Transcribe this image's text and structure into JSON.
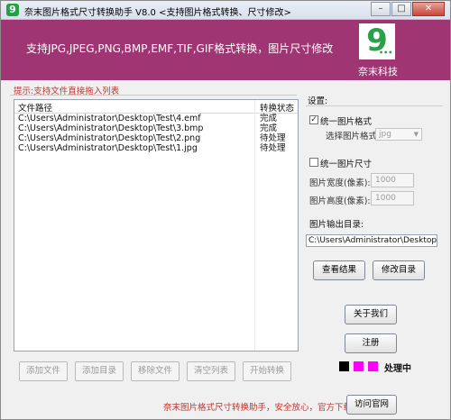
{
  "window": {
    "title": "奈末图片格式尺寸转换助手 V8.0   <支持图片格式转换、尺寸修改>",
    "app_icon_glyph": "9"
  },
  "banner": {
    "text": "支持JPG,JPEG,PNG,BMP,EMF,TIF,GIF格式转换，图片尺寸修改",
    "logo_glyph": "9",
    "logo_dots": "•••",
    "logo_caption": "奈末科技",
    "bg_color": "#a03574"
  },
  "hint": "提示:支持文件直接拖入列表",
  "file_list": {
    "headers": {
      "path": "文件路径",
      "status": "转换状态"
    },
    "rows": [
      {
        "path": "C:\\Users\\Administrator\\Desktop\\Test\\4.emf",
        "status": "完成"
      },
      {
        "path": "C:\\Users\\Administrator\\Desktop\\Test\\3.bmp",
        "status": "完成"
      },
      {
        "path": "C:\\Users\\Administrator\\Desktop\\Test\\2.png",
        "status": "待处理"
      },
      {
        "path": "C:\\Users\\Administrator\\Desktop\\Test\\1.jpg",
        "status": "待处理"
      }
    ]
  },
  "list_buttons": {
    "add_file": "添加文件",
    "add_dir": "添加目录",
    "remove_file": "移除文件",
    "clear_list": "清空列表",
    "start": "开始转换"
  },
  "settings": {
    "label": "设置:",
    "unify_format": {
      "label": "统一图片格式",
      "checked": true
    },
    "format_select": {
      "label": "选择图片格式:",
      "value": "jpg"
    },
    "unify_size": {
      "label": "统一图片尺寸",
      "checked": false
    },
    "width": {
      "label": "图片宽度(像素):",
      "value": "1000"
    },
    "height": {
      "label": "图片高度(像素):",
      "value": "1000"
    },
    "output_dir": {
      "label": "图片输出目录:",
      "value": "C:\\Users\\Administrator\\Desktop"
    },
    "view_result": "查看结果",
    "modify_dir": "修改目录",
    "about": "关于我们",
    "register": "注册"
  },
  "status": {
    "squares": [
      "#000000",
      "#ff00ff",
      "#ff00ff"
    ],
    "text": "处理中"
  },
  "footer": {
    "text": "奈末图片格式尺寸转换助手，安全放心，官方下载--",
    "visit_site": "访问官网"
  }
}
